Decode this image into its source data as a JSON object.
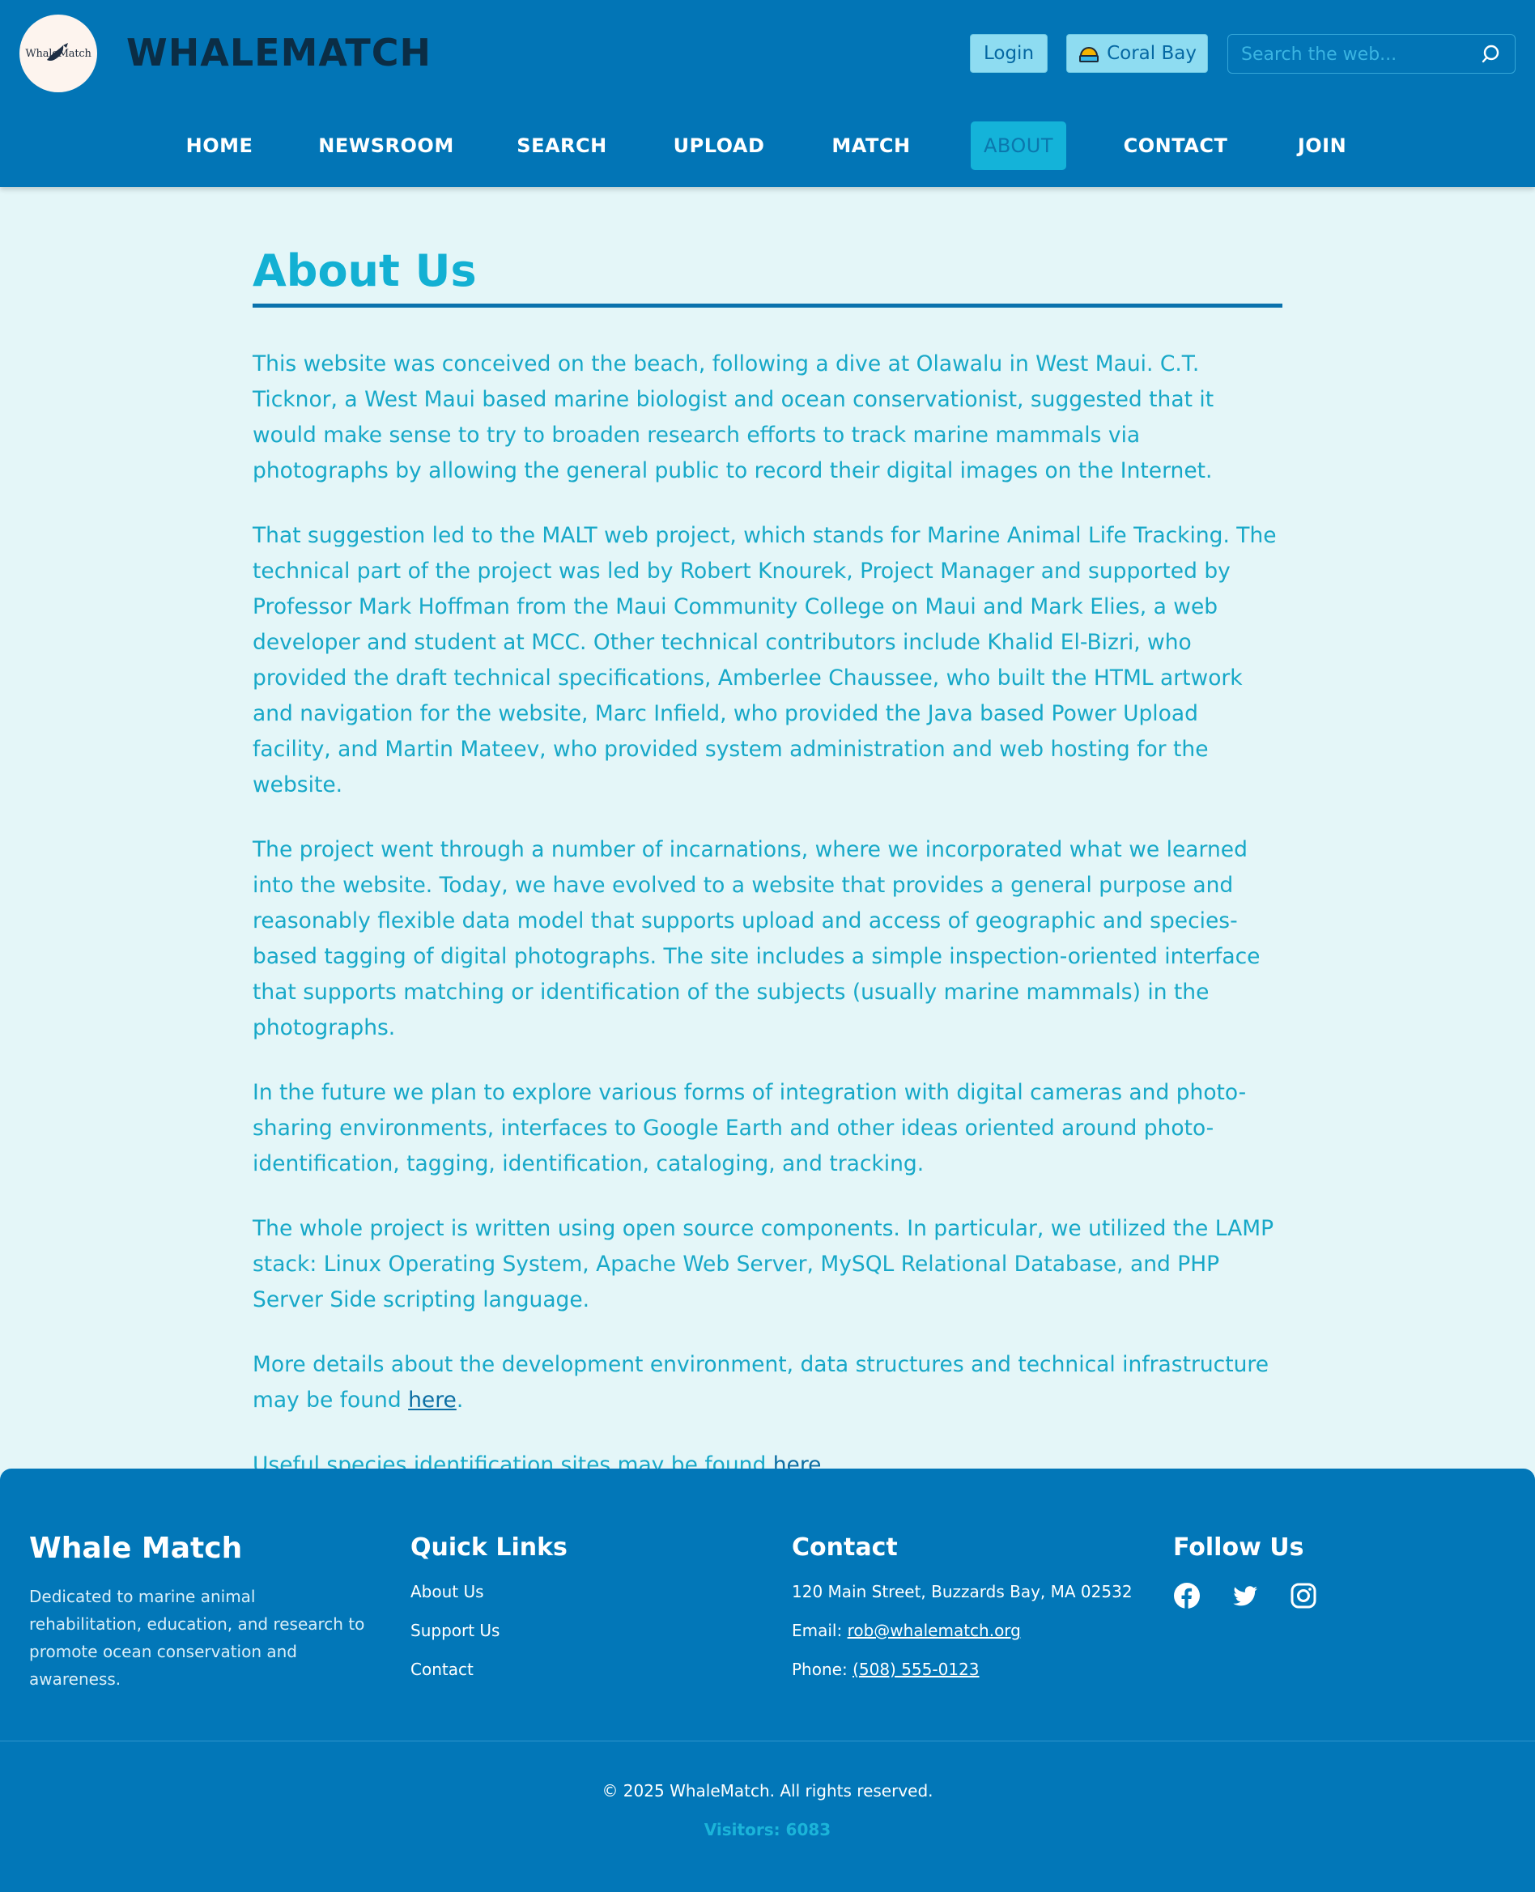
{
  "header": {
    "logo_text": "WhaleMatch",
    "brand": "WHALEMATCH",
    "login_label": "Login",
    "location_label": "Coral Bay",
    "search_placeholder": "Search the web..."
  },
  "nav": {
    "items": [
      "HOME",
      "NEWSROOM",
      "SEARCH",
      "UPLOAD",
      "MATCH",
      "ABOUT",
      "CONTACT",
      "JOIN"
    ],
    "active": "ABOUT"
  },
  "main": {
    "title": "About Us",
    "paragraphs": [
      "This website was conceived on the beach, following a dive at Olawalu in West Maui. C.T. Ticknor, a West Maui based marine biologist and ocean conservationist, suggested that it would make sense to try to broaden research efforts to track marine mammals via photographs by allowing the general public to record their digital images on the Internet.",
      "That suggestion led to the MALT web project, which stands for Marine Animal Life Tracking. The technical part of the project was led by Robert Knourek, Project Manager and supported by Professor Mark Hoffman from the Maui Community College on Maui and Mark Elies, a web developer and student at MCC. Other technical contributors include Khalid El-Bizri, who provided the draft technical specifications, Amberlee Chaussee, who built the HTML artwork and navigation for the website, Marc Infield, who provided the Java based Power Upload facility, and Martin Mateev, who provided system administration and web hosting for the website.",
      "The project went through a number of incarnations, where we incorporated what we learned into the website. Today, we have evolved to a website that provides a general purpose and reasonably flexible data model that supports upload and access of geographic and species-based tagging of digital photographs. The site includes a simple inspection-oriented interface that supports matching or identification of the subjects (usually marine mammals) in the photographs.",
      "In the future we plan to explore various forms of integration with digital cameras and photo-sharing environments, interfaces to Google Earth and other ideas oriented around photo-identification, tagging, identification, cataloging, and tracking.",
      "The whole project is written using open source components. In particular, we utilized the LAMP stack: Linux Operating System, Apache Web Server, MySQL Relational Database, and PHP Server Side scripting language."
    ],
    "details_text": "More details about the development environment, data structures and technical infrastructure may be found ",
    "details_link": "here",
    "details_end": ".",
    "species_text": "Useful species identification sites may be found ",
    "species_link": "here ",
    "species_end": "."
  },
  "footer": {
    "brand": "Whale Match",
    "description": "Dedicated to marine animal rehabilitation, education, and research to promote ocean conservation and awareness.",
    "quick_links_heading": "Quick Links",
    "quick_links": [
      "About Us",
      "Support Us",
      "Contact"
    ],
    "contact_heading": "Contact",
    "address": "120 Main Street, Buzzards Bay, MA 02532",
    "email_label": "Email: ",
    "email": "rob@whalematch.org",
    "phone_label": "Phone: ",
    "phone": "(508) 555-0123",
    "follow_heading": "Follow Us",
    "socials": [
      "facebook-icon",
      "twitter-icon",
      "instagram-icon"
    ],
    "copyright": "© 2025 WhaleMatch. All rights reserved.",
    "visitors": "Visitors: 6083"
  },
  "colors": {
    "header_bg": "#0275b6",
    "page_bg": "#e4f6f8",
    "accent": "#14b3d9",
    "text": "#17a8c8",
    "footer_bg": "#0277b8"
  }
}
